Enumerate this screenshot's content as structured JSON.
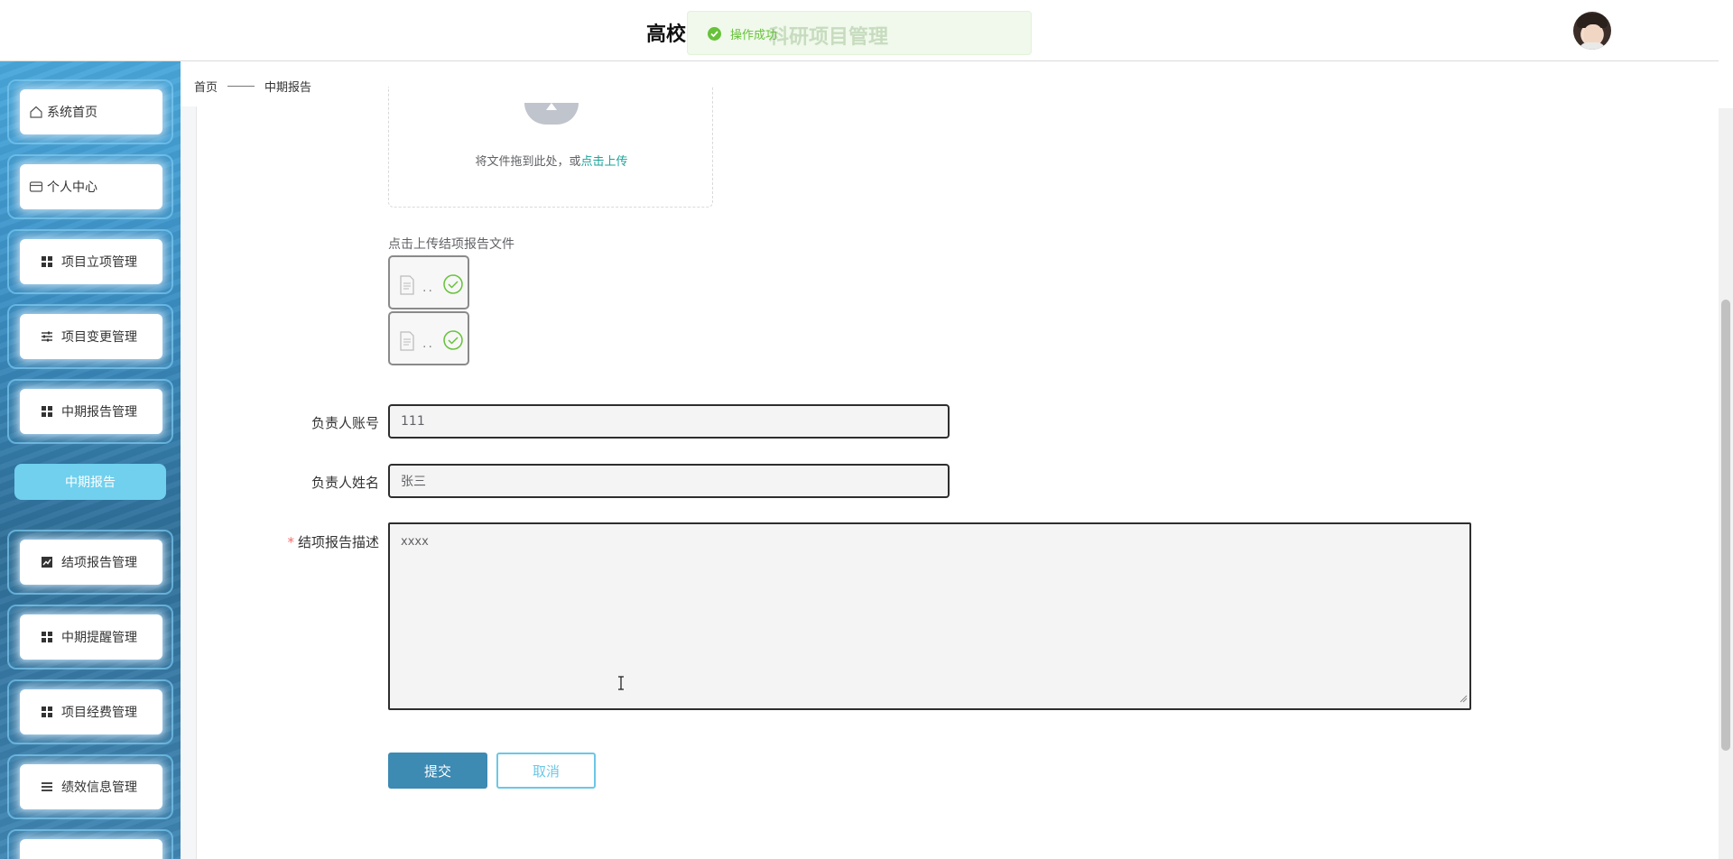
{
  "header": {
    "title": "高校",
    "title_overlay": "科研项目管理",
    "toast_text": "操作成功"
  },
  "sidebar": {
    "items": [
      {
        "label": "系统首页",
        "icon": "home-icon"
      },
      {
        "label": "个人中心",
        "icon": "card-icon"
      },
      {
        "label": "项目立项管理",
        "icon": "grid-icon"
      },
      {
        "label": "项目变更管理",
        "icon": "sliders-icon"
      },
      {
        "label": "中期报告管理",
        "icon": "grid-icon"
      },
      {
        "label": "结项报告管理",
        "icon": "chart-icon"
      },
      {
        "label": "中期提醒管理",
        "icon": "grid-icon"
      },
      {
        "label": "项目经费管理",
        "icon": "grid-icon"
      },
      {
        "label": "绩效信息管理",
        "icon": "list-icon"
      }
    ],
    "active_sub": "中期报告"
  },
  "breadcrumb": {
    "home": "首页",
    "current": "中期报告"
  },
  "upload": {
    "drag_text": "将文件拖到此处，或",
    "click_text": "点击上传"
  },
  "files": {
    "label": "点击上传结项报告文件",
    "placeholder": ".."
  },
  "form": {
    "account_label": "负责人账号",
    "account_value": "111",
    "name_label": "负责人姓名",
    "name_value": "张三",
    "desc_label": "结项报告描述",
    "desc_value": "xxxx",
    "submit": "提交",
    "cancel": "取消"
  },
  "colors": {
    "accent": "#3d8ab3",
    "link": "#1aa39a",
    "success": "#67c23a",
    "sidebar": "#3b8fc4"
  }
}
